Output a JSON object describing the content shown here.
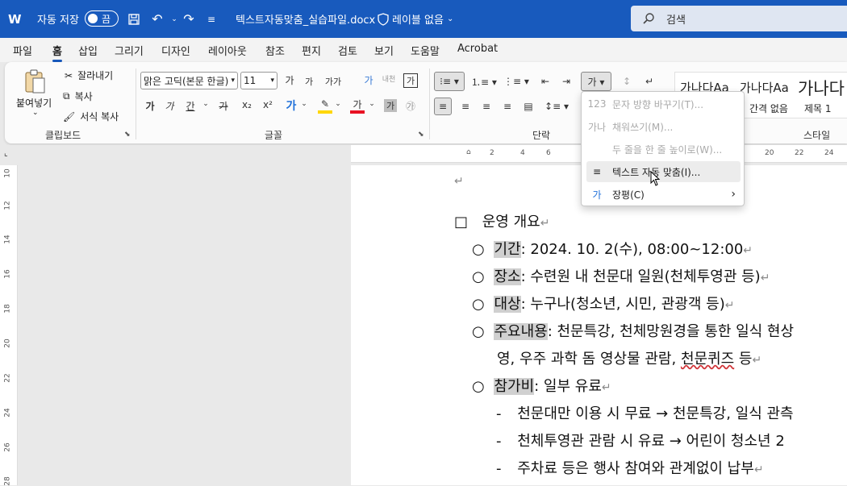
{
  "titlebar": {
    "app_icon": "W",
    "autosave_label": "자동 저장",
    "autosave_state": "끔",
    "document_name": "텍스트자동맞춤_실습파일.docx",
    "sensitivity_label": "레이블 없음",
    "search_placeholder": "검색"
  },
  "tabs": [
    "파일",
    "홈",
    "삽입",
    "그리기",
    "디자인",
    "레이아웃",
    "참조",
    "편지",
    "검토",
    "보기",
    "도움말",
    "Acrobat"
  ],
  "active_tab": "홈",
  "ribbon": {
    "clipboard": {
      "paste": "붙여넣기",
      "cut": "잘라내기",
      "copy": "복사",
      "format_painter": "서식 복사",
      "group": "클립보드"
    },
    "font": {
      "font_name": "맑은 고딕(본문 한글)",
      "font_size": "11",
      "group": "글꼴",
      "grow": "가",
      "shrink": "가",
      "case": "가가",
      "bold": "가",
      "italic": "가",
      "underline": "간",
      "strike": "가",
      "sub": "x₂",
      "sup": "x²",
      "highlight": "가",
      "color": "가",
      "shade": "가",
      "enclose": "㉮",
      "phonetic": "내천",
      "charborder": "가",
      "clear": "가"
    },
    "paragraph": {
      "group": "단락"
    },
    "styles": {
      "items": [
        "가나다Aa",
        "가나다Aa",
        "가나다"
      ],
      "captions": [
        "",
        "간격 없음",
        "제목 1"
      ],
      "group": "스타일"
    }
  },
  "ruler_top": [
    "2",
    "2",
    "4",
    "6",
    "20",
    "22",
    "24"
  ],
  "ruler_left": [
    "10",
    "12",
    "14",
    "16",
    "18",
    "20",
    "22",
    "24",
    "26",
    "28"
  ],
  "document": {
    "lines": [
      {
        "marker": "□",
        "text": "운영 개요"
      },
      {
        "marker": "○",
        "label": "기간",
        "rest": ": 2024. 10. 2(수), 08:00~12:00"
      },
      {
        "marker": "○",
        "label": "장소",
        "rest": ": 수련원 내 천문대 일원(천체투영관 등)"
      },
      {
        "marker": "○",
        "label": "대상",
        "rest": ": 누구나(청소년, 시민, 관광객 등)"
      },
      {
        "marker": "○",
        "label": "주요내용",
        "rest": ": 천문특강, 천체망원경을 통한 일식 현상"
      },
      {
        "text": "영, 우주 과학 돔 영상물 관람, ",
        "spelled": "천문퀴즈",
        "tail": " 등"
      },
      {
        "marker": "○",
        "label": "참가비",
        "rest": ": 일부 유료"
      },
      {
        "marker": "-",
        "text": "천문대만 이용 시 무료 → 천문특강, 일식 관측"
      },
      {
        "marker": "-",
        "text": "천체투영관 관람 시 유료 → 어린이 청소년 2"
      },
      {
        "marker": "-",
        "text": "주차료 등은 행사 참여와 관계없이 납부"
      }
    ]
  },
  "dropdown": {
    "items": [
      {
        "icon": "123",
        "label": "문자 방향 바꾸기(T)...",
        "disabled": true
      },
      {
        "icon": "가나",
        "label": "채워쓰기(M)...",
        "disabled": true
      },
      {
        "icon": "",
        "label": "두 줄을 한 줄 높이로(W)...",
        "disabled": true
      },
      {
        "icon": "≡",
        "label": "텍스트 자동 맞춤(I)...",
        "disabled": false
      },
      {
        "icon": "가",
        "label": "장평(C)",
        "disabled": false,
        "submenu": true
      }
    ]
  },
  "colors": {
    "accent": "#185abd",
    "highlight": "#d0d0d0",
    "font_color_bar": "#e81123",
    "highlight_bar": "#ffd700"
  }
}
